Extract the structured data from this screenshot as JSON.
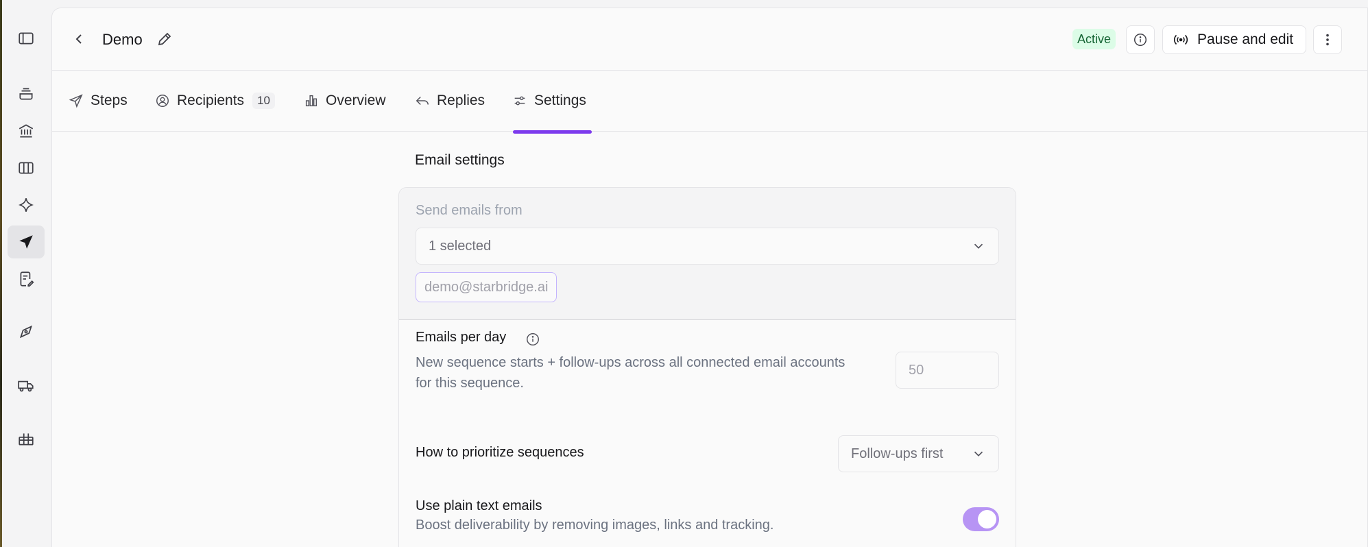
{
  "header": {
    "title": "Demo",
    "status": "Active",
    "pause_label": "Pause and edit"
  },
  "tabs": [
    {
      "label": "Steps",
      "icon": "send-icon"
    },
    {
      "label": "Recipients",
      "icon": "user-circle-icon",
      "count": "10"
    },
    {
      "label": "Overview",
      "icon": "bar-chart-icon"
    },
    {
      "label": "Replies",
      "icon": "reply-icon"
    },
    {
      "label": "Settings",
      "icon": "sliders-icon",
      "active": true
    }
  ],
  "settings": {
    "section_title": "Email settings",
    "send_from": {
      "label": "Send emails from",
      "value": "1 selected",
      "chip": "demo@starbridge.ai"
    },
    "emails_per_day": {
      "title": "Emails per day",
      "description": "New sequence starts + follow-ups across all connected email accounts for this sequence.",
      "value": "50"
    },
    "prioritize": {
      "title": "How to prioritize sequences",
      "value": "Follow-ups first"
    },
    "plain_text": {
      "title": "Use plain text emails",
      "description": "Boost deliverability by removing images, links and tracking.",
      "enabled": true
    }
  },
  "colors": {
    "accent": "#7c3aed",
    "status_bg": "#dcfce7",
    "toggle_on": "#b794f4"
  }
}
